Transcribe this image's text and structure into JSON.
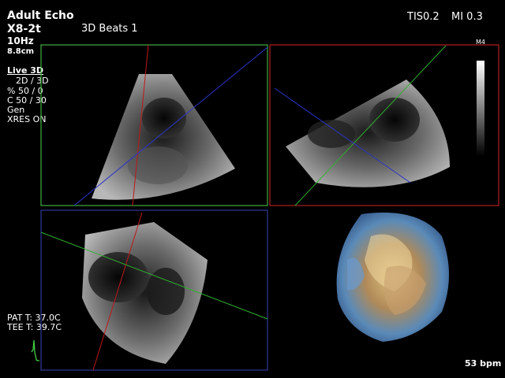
{
  "header": {
    "preset": "Adult Echo",
    "probe": "X8-2t",
    "frame_rate": "10Hz",
    "depth": "8.8cm",
    "mode_title": "3D Beats 1",
    "tis": "TIS0.2",
    "mi": "MI 0.3"
  },
  "settings": {
    "mode": "Live 3D",
    "line1": "2D / 3D",
    "line2": "% 50 / 0",
    "line3": "C  50 / 30",
    "line4": "Gen",
    "line5": "XRES ON"
  },
  "greyscale_map": {
    "label": "M4"
  },
  "temperatures": {
    "pat": "PAT T: 37.0C",
    "tee": "TEE T: 39.7C"
  },
  "heart_rate": "53 bpm",
  "colors": {
    "pane_green": "#3fae3f",
    "pane_red": "#b02020",
    "pane_blue": "#2e3a9a",
    "plane_red": "#c01818",
    "plane_blue": "#2a35c8",
    "plane_green": "#2eb02e",
    "ecg": "#3fd03f"
  }
}
